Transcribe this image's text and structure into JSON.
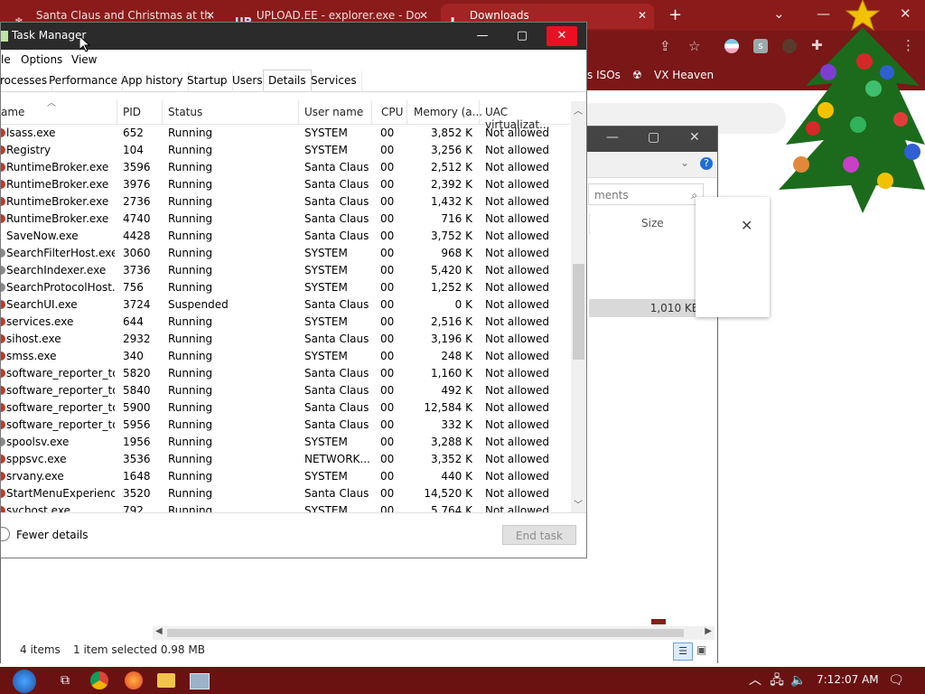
{
  "browser": {
    "tabs": [
      {
        "label": "Santa Claus and Christmas at th"
      },
      {
        "label": "UPLOAD.EE - explorer.exe - Do"
      },
      {
        "label": "Downloads"
      }
    ],
    "new_tab_glyph": "+",
    "bookmarks": [
      {
        "label": "s ISOs"
      },
      {
        "label": "VX Heaven"
      }
    ],
    "accent_color": "#8b1b1b"
  },
  "explorer": {
    "search_placeholder": "ments",
    "column_size": "Size",
    "selected_size": "1,010 KB",
    "status": {
      "items": "4 items",
      "selected": "1 item selected  0.98 MB"
    }
  },
  "taskmgr": {
    "title": "Task Manager",
    "menus": [
      "le",
      "Options",
      "View"
    ],
    "tabs": [
      "rocesses",
      "Performance",
      "App history",
      "Startup",
      "Users",
      "Details",
      "Services"
    ],
    "active_tab": "Details",
    "columns": [
      "ame",
      "PID",
      "Status",
      "User name",
      "CPU",
      "Memory (a...",
      "UAC virtualizat..."
    ],
    "rows": [
      {
        "name": "lsass.exe",
        "pid": "652",
        "status": "Running",
        "user": "SYSTEM",
        "cpu": "00",
        "mem": "3,852 K",
        "uac": "Not allowed",
        "icon": "red"
      },
      {
        "name": "Registry",
        "pid": "104",
        "status": "Running",
        "user": "SYSTEM",
        "cpu": "00",
        "mem": "3,256 K",
        "uac": "Not allowed",
        "icon": "red"
      },
      {
        "name": "RuntimeBroker.exe",
        "pid": "3596",
        "status": "Running",
        "user": "Santa Claus",
        "cpu": "00",
        "mem": "2,512 K",
        "uac": "Not allowed",
        "icon": "red"
      },
      {
        "name": "RuntimeBroker.exe",
        "pid": "3976",
        "status": "Running",
        "user": "Santa Claus",
        "cpu": "00",
        "mem": "2,392 K",
        "uac": "Not allowed",
        "icon": "red"
      },
      {
        "name": "RuntimeBroker.exe",
        "pid": "2736",
        "status": "Running",
        "user": "Santa Claus",
        "cpu": "00",
        "mem": "1,432 K",
        "uac": "Not allowed",
        "icon": "red"
      },
      {
        "name": "RuntimeBroker.exe",
        "pid": "4740",
        "status": "Running",
        "user": "Santa Claus",
        "cpu": "00",
        "mem": "716 K",
        "uac": "Not allowed",
        "icon": "red"
      },
      {
        "name": "SaveNow.exe",
        "pid": "4428",
        "status": "Running",
        "user": "Santa Claus",
        "cpu": "00",
        "mem": "3,752 K",
        "uac": "Not allowed",
        "icon": "none"
      },
      {
        "name": "SearchFilterHost.exe",
        "pid": "3060",
        "status": "Running",
        "user": "SYSTEM",
        "cpu": "00",
        "mem": "968 K",
        "uac": "Not allowed",
        "icon": "gear"
      },
      {
        "name": "SearchIndexer.exe",
        "pid": "3736",
        "status": "Running",
        "user": "SYSTEM",
        "cpu": "00",
        "mem": "5,420 K",
        "uac": "Not allowed",
        "icon": "gear"
      },
      {
        "name": "SearchProtocolHost....",
        "pid": "756",
        "status": "Running",
        "user": "SYSTEM",
        "cpu": "00",
        "mem": "1,252 K",
        "uac": "Not allowed",
        "icon": "gear"
      },
      {
        "name": "SearchUI.exe",
        "pid": "3724",
        "status": "Suspended",
        "user": "Santa Claus",
        "cpu": "00",
        "mem": "0 K",
        "uac": "Not allowed",
        "icon": "red"
      },
      {
        "name": "services.exe",
        "pid": "644",
        "status": "Running",
        "user": "SYSTEM",
        "cpu": "00",
        "mem": "2,516 K",
        "uac": "Not allowed",
        "icon": "red"
      },
      {
        "name": "sihost.exe",
        "pid": "2932",
        "status": "Running",
        "user": "Santa Claus",
        "cpu": "00",
        "mem": "3,196 K",
        "uac": "Not allowed",
        "icon": "red"
      },
      {
        "name": "smss.exe",
        "pid": "340",
        "status": "Running",
        "user": "SYSTEM",
        "cpu": "00",
        "mem": "248 K",
        "uac": "Not allowed",
        "icon": "red"
      },
      {
        "name": "software_reporter_to...",
        "pid": "5820",
        "status": "Running",
        "user": "Santa Claus",
        "cpu": "00",
        "mem": "1,160 K",
        "uac": "Not allowed",
        "icon": "red"
      },
      {
        "name": "software_reporter_to...",
        "pid": "5840",
        "status": "Running",
        "user": "Santa Claus",
        "cpu": "00",
        "mem": "492 K",
        "uac": "Not allowed",
        "icon": "red"
      },
      {
        "name": "software_reporter_to...",
        "pid": "5900",
        "status": "Running",
        "user": "Santa Claus",
        "cpu": "00",
        "mem": "12,584 K",
        "uac": "Not allowed",
        "icon": "red"
      },
      {
        "name": "software_reporter_to...",
        "pid": "5956",
        "status": "Running",
        "user": "Santa Claus",
        "cpu": "00",
        "mem": "332 K",
        "uac": "Not allowed",
        "icon": "red"
      },
      {
        "name": "spoolsv.exe",
        "pid": "1956",
        "status": "Running",
        "user": "SYSTEM",
        "cpu": "00",
        "mem": "3,288 K",
        "uac": "Not allowed",
        "icon": "gear"
      },
      {
        "name": "sppsvc.exe",
        "pid": "3536",
        "status": "Running",
        "user": "NETWORK...",
        "cpu": "00",
        "mem": "3,352 K",
        "uac": "Not allowed",
        "icon": "red"
      },
      {
        "name": "srvany.exe",
        "pid": "1648",
        "status": "Running",
        "user": "SYSTEM",
        "cpu": "00",
        "mem": "440 K",
        "uac": "Not allowed",
        "icon": "red"
      },
      {
        "name": "StartMenuExperienc...",
        "pid": "3520",
        "status": "Running",
        "user": "Santa Claus",
        "cpu": "00",
        "mem": "14,520 K",
        "uac": "Not allowed",
        "icon": "red"
      },
      {
        "name": "svchost.exe",
        "pid": "792",
        "status": "Running",
        "user": "SYSTEM",
        "cpu": "00",
        "mem": "5,764 K",
        "uac": "Not allowed",
        "icon": "red"
      }
    ],
    "footer": {
      "fewer_details": "Fewer details",
      "end_task": "End task"
    }
  },
  "taskbar": {
    "clock": "7:12:07 AM"
  }
}
